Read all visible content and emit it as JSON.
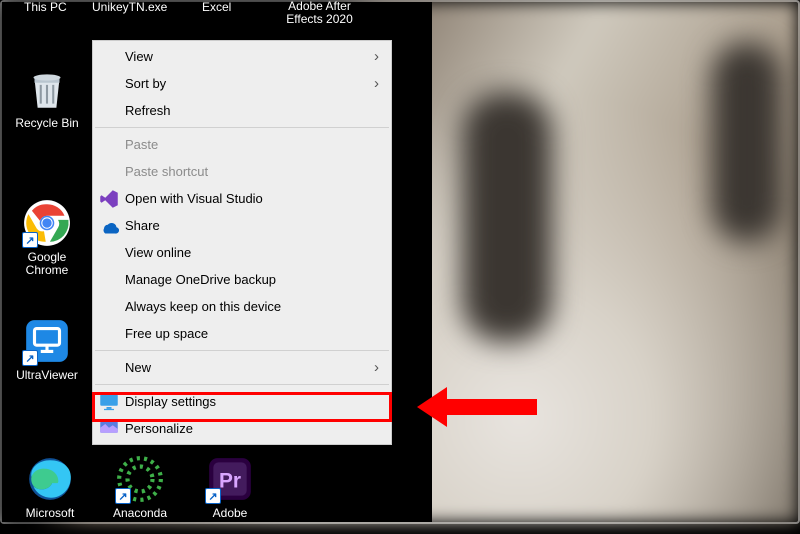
{
  "top_labels": {
    "a": "This PC",
    "b": "UnikeyTN.exe",
    "c": "Excel",
    "d": "Adobe After Effects 2020"
  },
  "desktop": {
    "recycle_bin": "Recycle Bin",
    "chrome": "Google Chrome",
    "ultraviewer": "UltraViewer",
    "edge": "Microsoft",
    "anaconda": "Anaconda",
    "premiere": "Adobe"
  },
  "context_menu": {
    "view": "View",
    "sort_by": "Sort by",
    "refresh": "Refresh",
    "paste": "Paste",
    "paste_shortcut": "Paste shortcut",
    "open_vs": "Open with Visual Studio",
    "share": "Share",
    "view_online": "View online",
    "manage_onedrive": "Manage OneDrive backup",
    "always_keep": "Always keep on this device",
    "free_up": "Free up space",
    "new": "New",
    "display_settings": "Display settings",
    "personalize": "Personalize"
  }
}
